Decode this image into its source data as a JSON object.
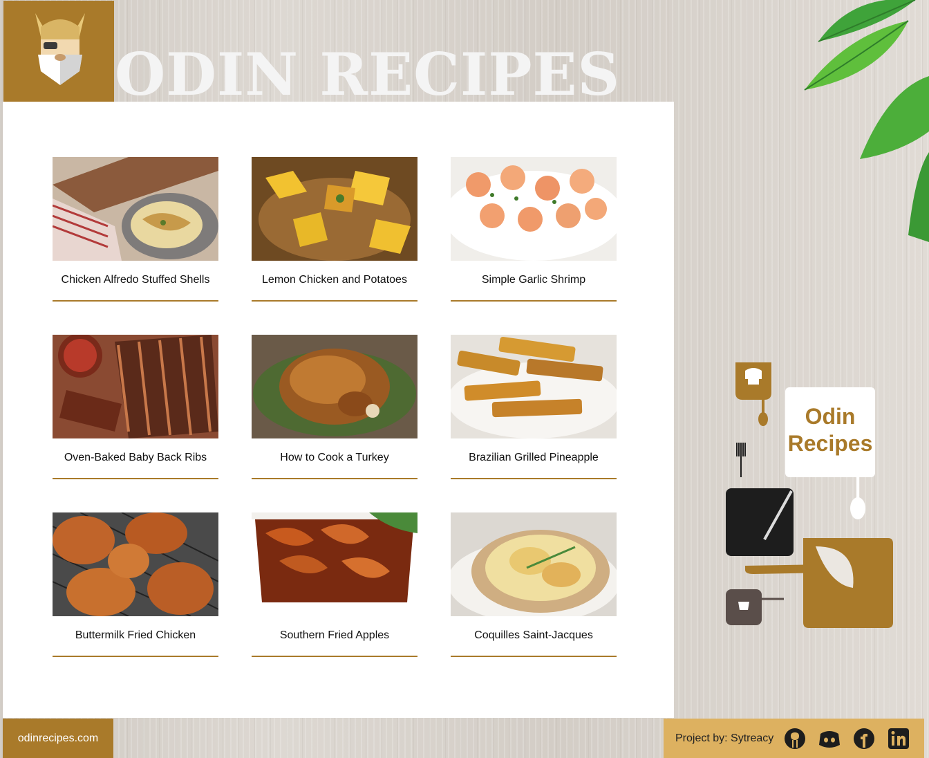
{
  "header": {
    "title": "ODIN RECIPES",
    "logo_icon": "viking-head-icon"
  },
  "recipes": [
    {
      "title": "Chicken Alfredo Stuffed Shells"
    },
    {
      "title": "Lemon Chicken and Potatoes"
    },
    {
      "title": "Simple Garlic Shrimp"
    },
    {
      "title": "Oven-Baked Baby Back Ribs"
    },
    {
      "title": "How to Cook a Turkey"
    },
    {
      "title": "Brazilian Grilled Pineapple"
    },
    {
      "title": "Buttermilk Fried Chicken"
    },
    {
      "title": "Southern Fried Apples"
    },
    {
      "title": "Coquilles Saint-Jacques"
    }
  ],
  "side_graphic": {
    "line1": "Odin",
    "line2": "Recipes"
  },
  "footer": {
    "site": "odinrecipes.com",
    "credit": "Project by: Sytreacy",
    "social": [
      "github-icon",
      "discord-icon",
      "facebook-icon",
      "linkedin-icon"
    ]
  },
  "colors": {
    "accent": "#a97a2a",
    "footer_right": "#ddb160",
    "panel": "#ffffff",
    "wood": "#d8d3cd"
  }
}
